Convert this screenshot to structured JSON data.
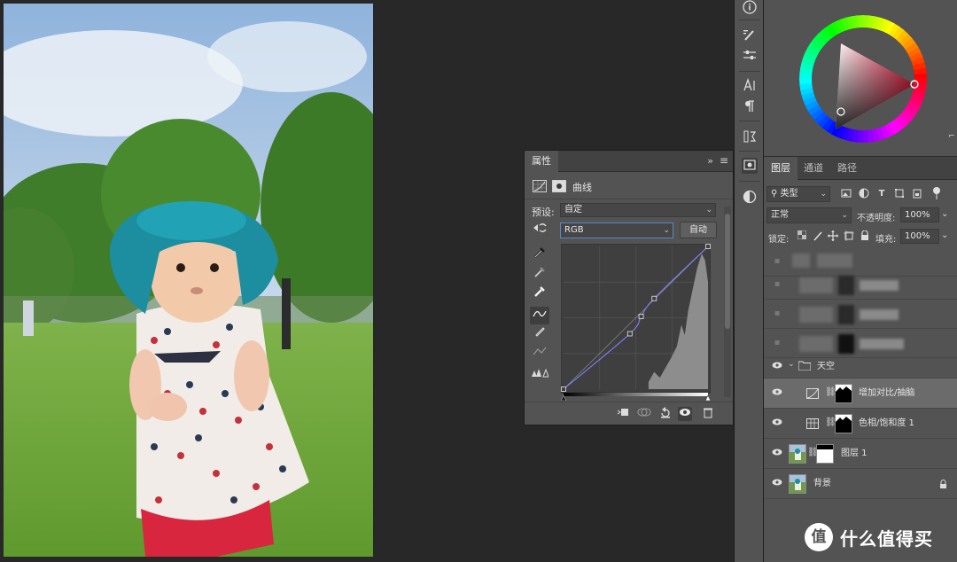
{
  "properties": {
    "tab": "属性",
    "collapse": "»",
    "adjustment_name": "曲线",
    "preset_label": "预设:",
    "preset_value": "自定",
    "channel_value": "RGB",
    "auto_button": "自动"
  },
  "curve": {
    "points": [
      [
        0,
        0
      ],
      [
        117,
        99
      ],
      [
        137,
        130
      ],
      [
        160,
        162
      ],
      [
        255,
        255
      ]
    ]
  },
  "layers": {
    "tabs": [
      "图层",
      "通道",
      "路径"
    ],
    "filter_kind": "类型",
    "blend_mode": "正常",
    "opacity_label": "不透明度:",
    "opacity_value": "100%",
    "lock_label": "锁定:",
    "fill_label": "填充:",
    "fill_value": "100%",
    "group_name": "天空",
    "items": [
      {
        "name": "增加对比/抽脑"
      },
      {
        "name": "色相/饱和度 1"
      },
      {
        "name": "图层 1"
      },
      {
        "name": "背景"
      }
    ]
  },
  "watermark": {
    "logo": "值",
    "text": "什么值得买"
  },
  "colors": {
    "panel": "#535353",
    "canvas_bg": "#282828",
    "accent": "#e8173a"
  }
}
